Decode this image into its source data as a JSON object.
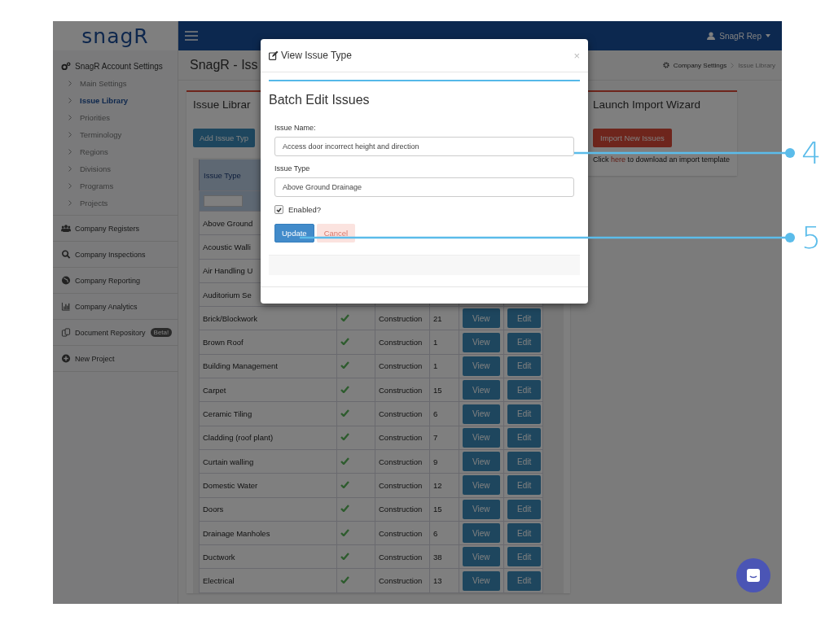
{
  "app": {
    "logo": "snagR",
    "user": "SnagR Rep"
  },
  "sidebar": {
    "group": {
      "label": "SnagR Account Settings",
      "items": [
        {
          "label": "Main Settings",
          "selected": false
        },
        {
          "label": "Issue Library",
          "selected": true
        },
        {
          "label": "Priorities",
          "selected": false
        },
        {
          "label": "Terminology",
          "selected": false
        },
        {
          "label": "Regions",
          "selected": false
        },
        {
          "label": "Divisions",
          "selected": false
        },
        {
          "label": "Programs",
          "selected": false
        },
        {
          "label": "Projects",
          "selected": false
        }
      ]
    },
    "sections": [
      {
        "label": "Company Registers"
      },
      {
        "label": "Company Inspections"
      },
      {
        "label": "Company Reporting"
      },
      {
        "label": "Company Analytics"
      },
      {
        "label": "Document Repository",
        "badge": "Beta!"
      },
      {
        "label": "New Project"
      }
    ]
  },
  "page": {
    "title": "SnagR - Iss",
    "breadcrumb": [
      "Company Settings",
      "Issue Library"
    ]
  },
  "library_panel": {
    "title": "Issue Librar",
    "add_button": "Add Issue Typ",
    "table": {
      "columns": [
        "Issue Type"
      ],
      "rows": [
        {
          "name": "Above Ground"
        },
        {
          "name": "Acoustic Walli"
        },
        {
          "name": "Air Handling U"
        },
        {
          "name": "Auditorium Se"
        },
        {
          "name": "Brick/Blockwork",
          "enabled": true,
          "category": "Construction",
          "count": "21",
          "view": "View",
          "edit": "Edit"
        },
        {
          "name": "Brown Roof",
          "enabled": true,
          "category": "Construction",
          "count": "1",
          "view": "View",
          "edit": "Edit"
        },
        {
          "name": "Building Management",
          "enabled": true,
          "category": "Construction",
          "count": "1",
          "view": "View",
          "edit": "Edit"
        },
        {
          "name": "Carpet",
          "enabled": true,
          "category": "Construction",
          "count": "15",
          "view": "View",
          "edit": "Edit"
        },
        {
          "name": "Ceramic Tiling",
          "enabled": true,
          "category": "Construction",
          "count": "6",
          "view": "View",
          "edit": "Edit"
        },
        {
          "name": "Cladding (roof plant)",
          "enabled": true,
          "category": "Construction",
          "count": "7",
          "view": "View",
          "edit": "Edit"
        },
        {
          "name": "Curtain walling",
          "enabled": true,
          "category": "Construction",
          "count": "9",
          "view": "View",
          "edit": "Edit"
        },
        {
          "name": "Domestic Water",
          "enabled": true,
          "category": "Construction",
          "count": "12",
          "view": "View",
          "edit": "Edit"
        },
        {
          "name": "Doors",
          "enabled": true,
          "category": "Construction",
          "count": "15",
          "view": "View",
          "edit": "Edit"
        },
        {
          "name": "Drainage Manholes",
          "enabled": true,
          "category": "Construction",
          "count": "6",
          "view": "View",
          "edit": "Edit"
        },
        {
          "name": "Ductwork",
          "enabled": true,
          "category": "Construction",
          "count": "38",
          "view": "View",
          "edit": "Edit"
        },
        {
          "name": "Electrical",
          "enabled": true,
          "category": "Construction",
          "count": "13",
          "view": "View",
          "edit": "Edit"
        }
      ]
    }
  },
  "import_panel": {
    "title": "Launch Import Wizard",
    "button": "Import New Issues",
    "note_before": "Click",
    "link": "here",
    "note_after": "to download an import template"
  },
  "modal": {
    "title": "View Issue Type",
    "close": "×",
    "heading": "Batch Edit Issues",
    "fields": [
      {
        "label": "Issue Name:",
        "value": "Access door incorrect height and direction"
      },
      {
        "label": "Issue Type",
        "value": "Above Ground Drainage"
      }
    ],
    "enabled": {
      "label": "Enabled?",
      "checked": true
    },
    "buttons": [
      {
        "label": "Update",
        "kind": "primary"
      },
      {
        "label": "Cancel",
        "kind": "cancel"
      }
    ]
  },
  "callouts": [
    {
      "number": "4"
    },
    {
      "number": "5"
    }
  ]
}
